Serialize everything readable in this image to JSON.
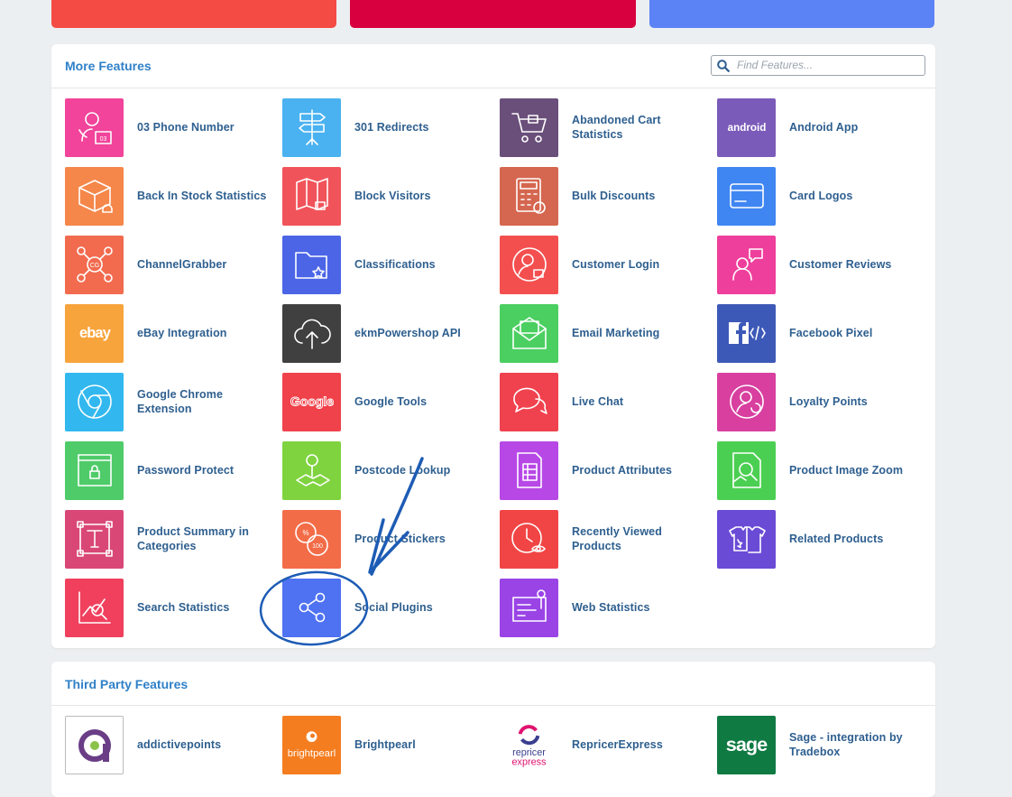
{
  "top_tiles": [
    {
      "color": "#f44b44"
    },
    {
      "color": "#d9003f"
    },
    {
      "color": "#5b83f5"
    }
  ],
  "more_features": {
    "title": "More Features",
    "search_placeholder": "Find Features...",
    "items": [
      {
        "label": "03 Phone Number",
        "color": "#f1449a",
        "icon": "phone-number-icon"
      },
      {
        "label": "301 Redirects",
        "color": "#4ab2f0",
        "icon": "signpost-icon"
      },
      {
        "label": "Abandoned Cart Statistics",
        "color": "#6a4f7a",
        "icon": "cart-icon"
      },
      {
        "label": "Android App",
        "color": "#7b5bba",
        "icon": "android-logo-icon",
        "text": "android"
      },
      {
        "label": "Back In Stock Statistics",
        "color": "#f5874a",
        "icon": "box-bell-icon"
      },
      {
        "label": "Block Visitors",
        "color": "#f0545a",
        "icon": "map-lock-icon"
      },
      {
        "label": "Bulk Discounts",
        "color": "#d5664f",
        "icon": "calculator-icon"
      },
      {
        "label": "Card Logos",
        "color": "#3f86f2",
        "icon": "credit-card-icon"
      },
      {
        "label": "ChannelGrabber",
        "color": "#f26b4f",
        "icon": "channelgrabber-icon",
        "text": "CG"
      },
      {
        "label": "Classifications",
        "color": "#4b65e6",
        "icon": "folder-star-icon"
      },
      {
        "label": "Customer Login",
        "color": "#f44f4f",
        "icon": "user-lock-icon"
      },
      {
        "label": "Customer Reviews",
        "color": "#ef3f9c",
        "icon": "user-chat-icon"
      },
      {
        "label": "eBay Integration",
        "color": "#f7a43c",
        "icon": "ebay-logo-icon",
        "text": "ebay"
      },
      {
        "label": "ekmPowershop API",
        "color": "#404040",
        "icon": "cloud-upload-icon"
      },
      {
        "label": "Email Marketing",
        "color": "#4bcf61",
        "icon": "envelope-icon"
      },
      {
        "label": "Facebook Pixel",
        "color": "#3d59b8",
        "icon": "facebook-code-icon"
      },
      {
        "label": "Google Chrome Extension",
        "color": "#32b8ef",
        "icon": "chrome-icon"
      },
      {
        "label": "Google Tools",
        "color": "#f0424a",
        "icon": "google-logo-icon",
        "text": "Google"
      },
      {
        "label": "Live Chat",
        "color": "#f0424e",
        "icon": "chat-bubbles-icon"
      },
      {
        "label": "Loyalty Points",
        "color": "#d83f9f",
        "icon": "user-refresh-icon"
      },
      {
        "label": "Password Protect",
        "color": "#4fcb6a",
        "icon": "browser-lock-icon"
      },
      {
        "label": "Postcode Lookup",
        "color": "#7fd33f",
        "icon": "map-pin-icon"
      },
      {
        "label": "Product Attributes",
        "color": "#b748e6",
        "icon": "document-list-icon"
      },
      {
        "label": "Product Image Zoom",
        "color": "#4bcf52",
        "icon": "image-zoom-icon"
      },
      {
        "label": "Product Summary in Categories",
        "color": "#d94777",
        "icon": "text-frame-icon"
      },
      {
        "label": "Product Stickers",
        "color": "#f36c48",
        "icon": "stickers-icon"
      },
      {
        "label": "Recently Viewed Products",
        "color": "#f14545",
        "icon": "clock-eye-icon"
      },
      {
        "label": "Related Products",
        "color": "#6a4bd6",
        "icon": "tshirts-icon"
      },
      {
        "label": "Search Statistics",
        "color": "#f0405e",
        "icon": "chart-search-icon"
      },
      {
        "label": "Social Plugins",
        "color": "#4f72f2",
        "icon": "share-icon"
      },
      {
        "label": "Web Statistics",
        "color": "#9a44e6",
        "icon": "web-stats-icon"
      }
    ]
  },
  "third_party": {
    "title": "Third Party Features",
    "items": [
      {
        "label": "addictivepoints",
        "icon": "addictivepoints-logo-icon",
        "color": "#6a3d86"
      },
      {
        "label": "Brightpearl",
        "icon": "brightpearl-logo-icon",
        "color": "#f47d20",
        "text": "brightpearl"
      },
      {
        "label": "RepricerExpress",
        "icon": "repricerexpress-logo-icon",
        "color": "#e0136f",
        "text1": "repricer",
        "text2": "express"
      },
      {
        "label": "Sage - integration by Tradebox",
        "icon": "sage-logo-icon",
        "color": "#0f7a42",
        "text": "sage"
      }
    ]
  }
}
